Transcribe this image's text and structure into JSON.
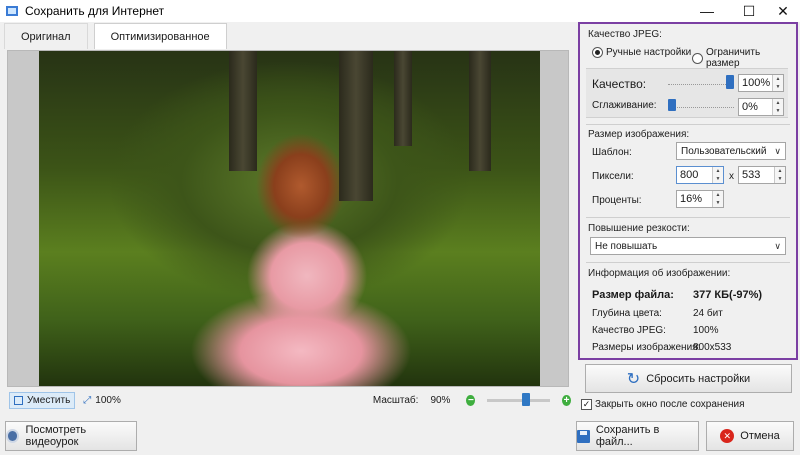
{
  "window": {
    "title": "Сохранить для Интернет",
    "minimize": "—",
    "maximize": "☐",
    "close": "✕"
  },
  "tabs": [
    {
      "label": "Оригинал"
    },
    {
      "label": "Оптимизированное"
    }
  ],
  "preview": {
    "fit_label": "Уместить",
    "actual_label": "100%",
    "scale_label": "Масштаб:",
    "scale_value": "90%",
    "zoom_fraction": 0.5,
    "zoom_minus": "−",
    "zoom_plus": "+"
  },
  "jpeg": {
    "section_title": "Качество JPEG:",
    "mode_manual": "Ручные настройки",
    "mode_limit": "Ограничить размер",
    "selected_mode": "manual",
    "quality_label": "Качество:",
    "quality_value": "100%",
    "quality_fraction": 1.0,
    "smoothing_label": "Сглаживание:",
    "smoothing_value": "0%",
    "smoothing_fraction": 0.0
  },
  "image_size": {
    "section_title": "Размер изображения:",
    "template_label": "Шаблон:",
    "template_value": "Пользовательский",
    "pixels_label": "Пиксели:",
    "width": "800",
    "times": "x",
    "height": "533",
    "percent_label": "Проценты:",
    "percent_value": "16%"
  },
  "sharpen": {
    "section_title": "Повышение резкости:",
    "value": "Не повышать"
  },
  "info": {
    "section_title": "Информация об изображении:",
    "rows": [
      {
        "label": "Размер файла:",
        "value": "377 КБ(-97%)",
        "bold": true
      },
      {
        "label": "Глубина цвета:",
        "value": "24 бит"
      },
      {
        "label": "Качество JPEG:",
        "value": "100%"
      },
      {
        "label": "Размеры изображения:",
        "value": "800x533"
      }
    ]
  },
  "actions": {
    "reset_label": "Сбросить настройки",
    "close_after_save_label": "Закрыть окно после сохранения",
    "close_after_save_checked": true,
    "checkmark": "✓",
    "video_label": "Посмотреть видеоурок",
    "save_label": "Сохранить в файл...",
    "cancel_label": "Отмена"
  },
  "colors": {
    "panel_border": "#7b3fa3",
    "accent": "#2f6fc0",
    "zoom_green": "#3fae3f",
    "cancel_red": "#d9261c"
  }
}
